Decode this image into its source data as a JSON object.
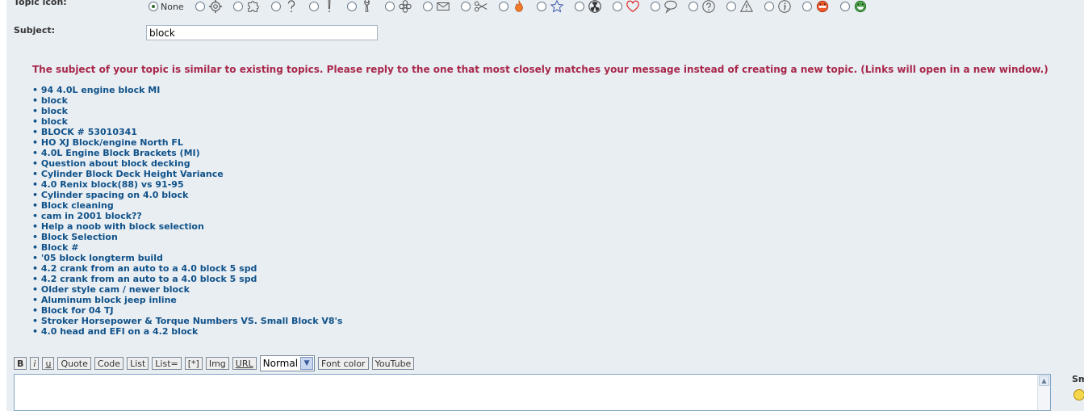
{
  "form": {
    "topic_icon_label": "Topic icon:",
    "none_label": "None",
    "subject_label": "Subject:",
    "subject_value": "block"
  },
  "icons": [
    "settings-icon",
    "puzzle-icon",
    "question-icon",
    "exclamation-icon",
    "wrench-icon",
    "flower-icon",
    "envelope-icon",
    "scissors-icon",
    "fire-icon",
    "star-icon",
    "radioactive-icon",
    "heart-icon",
    "speech-bubble-icon",
    "help-icon",
    "warning-icon",
    "info-icon",
    "angry-icon",
    "laugh-icon"
  ],
  "warning": "The subject of your topic is similar to existing topics. Please reply to the one that most closely matches your message instead of creating a new topic. (Links will open in a new window.)",
  "similar_topics": [
    "94 4.0L engine block MI",
    "block",
    "block",
    "block",
    "BLOCK # 53010341",
    "HO XJ Block/engine North FL",
    "4.0L Engine Block Brackets (MI)",
    "Question about block decking",
    "Cylinder Block Deck Height Variance",
    "4.0 Renix block(88) vs 91-95",
    "Cylinder spacing on 4.0 block",
    "Block cleaning",
    "cam in 2001 block??",
    "Help a noob with block selection",
    "Block Selection",
    "Block #",
    "'05 block longterm build",
    "4.2 crank from an auto to a 4.0 block 5 spd",
    "4.2 crank from an auto to a 4.0 block 5 spd",
    "Older style cam / newer block",
    "Aluminum block jeep inline",
    "Block for 04 TJ",
    "Stroker Horsepower & Torque Numbers VS. Small Block V8's",
    "4.0 head and EFI on a 4.2 block"
  ],
  "toolbar": {
    "bold": "B",
    "italic": "i",
    "underline": "u",
    "quote": "Quote",
    "code": "Code",
    "list": "List",
    "list_eq": "List=",
    "list_item": "[*]",
    "img": "Img",
    "url": "URL",
    "font_size_selected": "Normal",
    "font_color": "Font color",
    "youtube": "YouTube"
  },
  "smilies_label": "Sm"
}
